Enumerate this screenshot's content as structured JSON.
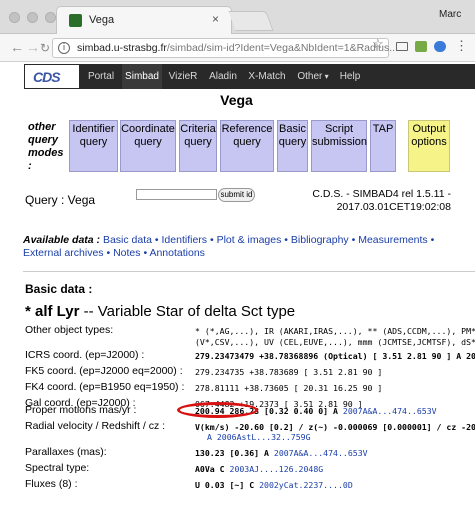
{
  "browser": {
    "tab_title": "Vega",
    "tab_close": "×",
    "user": "Marc",
    "url_host": "simbad.u-strasbg.fr",
    "url_path": "/simbad/sim-id?Ident=Vega&NbIdent=1&Radius...",
    "icons": [
      "back-icon",
      "forward-icon",
      "reload-icon",
      "info-icon",
      "star-icon",
      "menu-icon"
    ]
  },
  "nav": {
    "logo": "CDS",
    "items": [
      {
        "label": "Portal"
      },
      {
        "label": "Simbad"
      },
      {
        "label": "VizieR"
      },
      {
        "label": "Aladin"
      },
      {
        "label": "X-Match"
      },
      {
        "label": "Other"
      },
      {
        "label": "Help"
      }
    ]
  },
  "page_title": "Vega",
  "query_modes": {
    "label_line1": "other",
    "label_line2": "query",
    "label_line3": "modes",
    "label_line4": ":",
    "modes": [
      {
        "l1": "Identifier",
        "l2": "query"
      },
      {
        "l1": "Coordinate",
        "l2": "query"
      },
      {
        "l1": "Criteria",
        "l2": "query"
      },
      {
        "l1": "Reference",
        "l2": "query"
      },
      {
        "l1": "Basic",
        "l2": "query"
      },
      {
        "l1": "Script",
        "l2": "submission"
      },
      {
        "l1": "TAP",
        "l2": ""
      },
      {
        "l1": "Output",
        "l2": "options"
      }
    ]
  },
  "query": {
    "label": "Query : Vega",
    "input_value": "",
    "submit": "submit id",
    "version_line1": "C.D.S. - SIMBAD4 rel 1.5.11 -",
    "version_line2": "2017.03.01CET19:02:08"
  },
  "available": {
    "label": "Available data :",
    "links": [
      "Basic data",
      "Identifiers",
      "Plot & images",
      "Bibliography",
      "Measurements",
      "External archives",
      "Notes",
      "Annotations"
    ]
  },
  "basic": {
    "heading": "Basic data :",
    "name_star": "* alf Lyr",
    "name_rest": " -- Variable Star of delta Sct type",
    "other_types_label": "Other object types:",
    "other_types_l1": "* (*,AG,...), IR (AKARI,IRAS,...), ** (ADS,CCDM,...), PM* (",
    "other_types_l2": "(V*,CSV,...), UV (CEL,EUVE,...), mmm (JCMTSE,JCMTSF), dS* (",
    "icrs_label": "ICRS coord. (ep=J2000) :",
    "icrs_value": "279.23473479 +38.78368896 (Optical) [ 3.51 2.81 90 ] A 20",
    "fk5_label": "FK5 coord. (ep=J2000 eq=2000) :",
    "fk5_value": "279.234735 +38.783689 [ 3.51 2.81 90 ]",
    "fk4_label": "FK4 coord. (ep=B1950 eq=1950) :",
    "fk4_value": "278.81111 +38.73605 [ 20.31 16.25 90 ]",
    "gal_label": "Gal coord. (ep=J2000) :",
    "gal_value": "067.4482 +19.2373 [ 3.51 2.81 90 ]",
    "pm_label": "Proper motions mas/yr :",
    "pm_value": "200.94 286.23 [0.32 0.40 0] A",
    "pm_ref": "2007A&A...474..653V",
    "rv_label": "Radial velocity / Redshift / cz :",
    "rv_value": "V(km/s) -20.60 [0.2] / z(~) -0.000069 [0.000001] / cz -20",
    "rv_value2": "A 2006AstL...32..759G",
    "plx_label": "Parallaxes (mas):",
    "plx_value": "130.23 [0.36] A",
    "plx_ref": "2007A&A...474..653V",
    "sp_label": "Spectral type:",
    "sp_value": "A0Va C",
    "sp_ref": "2003AJ....126.2048G",
    "flux_label": "Fluxes (8) :",
    "flux_value": "U 0.03 [~] C",
    "flux_ref": "2002yCat.2237....0D"
  },
  "colors": {
    "nav_bg": "#292929",
    "mode_bg": "#c7c6f2",
    "output_bg": "#f6f389",
    "link": "#1a3ea8",
    "highlight": "#d81111"
  }
}
